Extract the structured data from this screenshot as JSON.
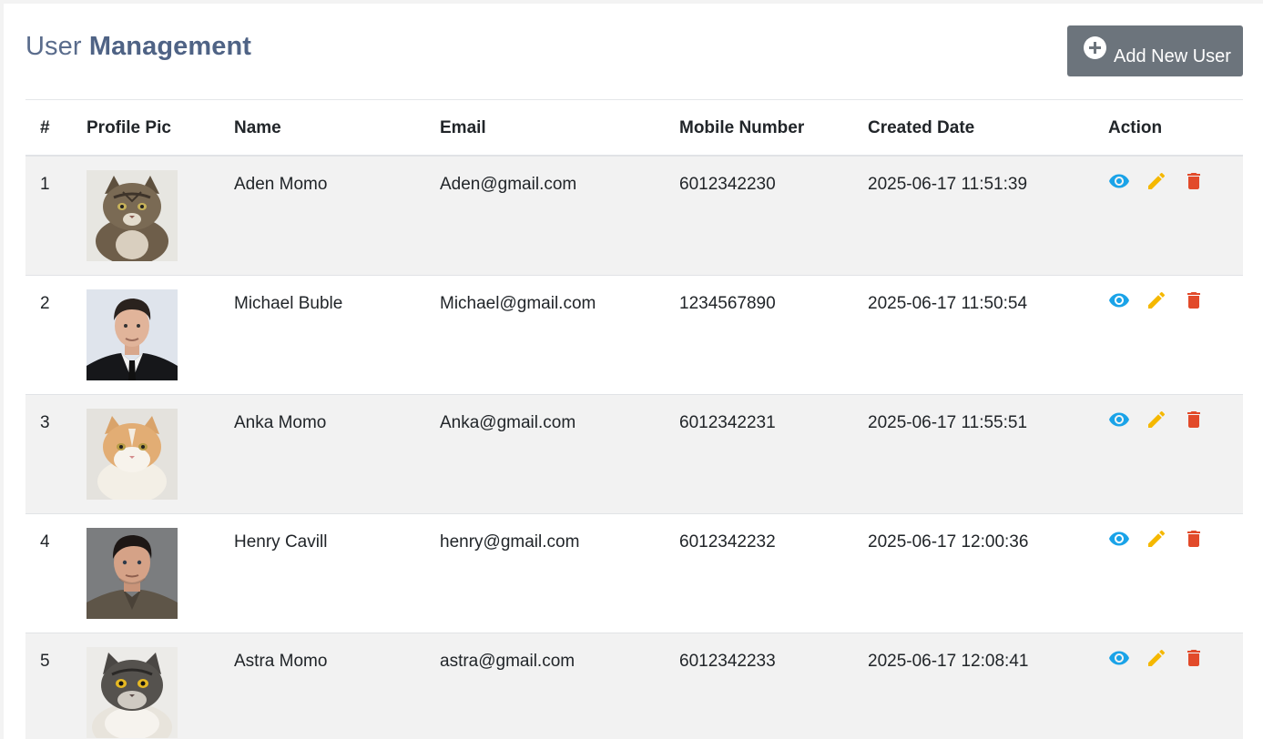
{
  "header": {
    "title_light": "User",
    "title_bold": "Management",
    "add_button_label": "Add New User"
  },
  "table": {
    "columns": [
      "#",
      "Profile Pic",
      "Name",
      "Email",
      "Mobile Number",
      "Created Date",
      "Action"
    ],
    "rows": [
      {
        "index": "1",
        "avatar": "cat-tabby-avatar",
        "name": "Aden Momo",
        "email": "Aden@gmail.com",
        "mobile": "6012342230",
        "created": "2025-06-17 11:51:39"
      },
      {
        "index": "2",
        "avatar": "man-in-suit-avatar",
        "name": "Michael Buble",
        "email": "Michael@gmail.com",
        "mobile": "1234567890",
        "created": "2025-06-17 11:50:54"
      },
      {
        "index": "3",
        "avatar": "cat-orange-white-avatar",
        "name": "Anka Momo",
        "email": "Anka@gmail.com",
        "mobile": "6012342231",
        "created": "2025-06-17 11:55:51"
      },
      {
        "index": "4",
        "avatar": "man-dark-hair-avatar",
        "name": "Henry Cavill",
        "email": "henry@gmail.com",
        "mobile": "6012342232",
        "created": "2025-06-17 12:00:36"
      },
      {
        "index": "5",
        "avatar": "cat-longhair-avatar",
        "name": "Astra Momo",
        "email": "astra@gmail.com",
        "mobile": "6012342233",
        "created": "2025-06-17 12:08:41"
      }
    ]
  },
  "icons": {
    "view": "eye-icon",
    "edit": "pencil-icon",
    "delete": "trash-icon",
    "add": "plus-circle-icon"
  },
  "colors": {
    "view": "#1aa3e8",
    "edit": "#f5b800",
    "delete": "#e24a2a",
    "button": "#6c747c",
    "title": "#5a6c8c"
  }
}
